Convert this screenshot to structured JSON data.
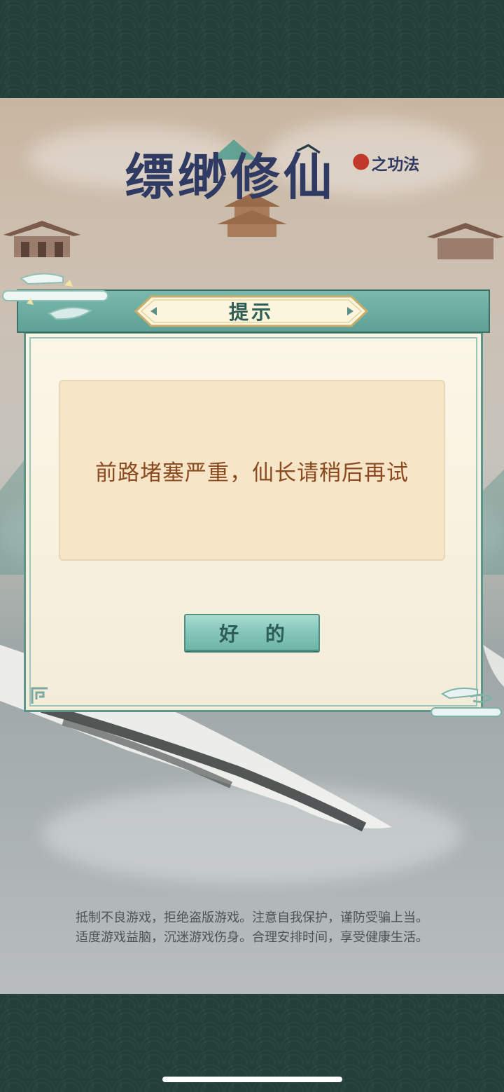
{
  "dialog": {
    "title": "提示",
    "message": "前路堵塞严重，仙长请稍后再试",
    "ok_label": "好 的"
  },
  "notice": {
    "line1": "抵制不良游戏，拒绝盗版游戏。注意自我保护，谨防受骗上当。",
    "line2": "适度游戏益脑，沉迷游戏伤身。合理安排时间，享受健康生活。"
  },
  "logo": {
    "main_text": "缥缈修仙",
    "sub_text": "之功法"
  },
  "colors": {
    "accent_teal": "#5fa196",
    "message_text": "#8a4a22",
    "band": "#233f38"
  },
  "icons": [
    "arrow-left-icon",
    "arrow-right-icon",
    "crane-icon"
  ]
}
